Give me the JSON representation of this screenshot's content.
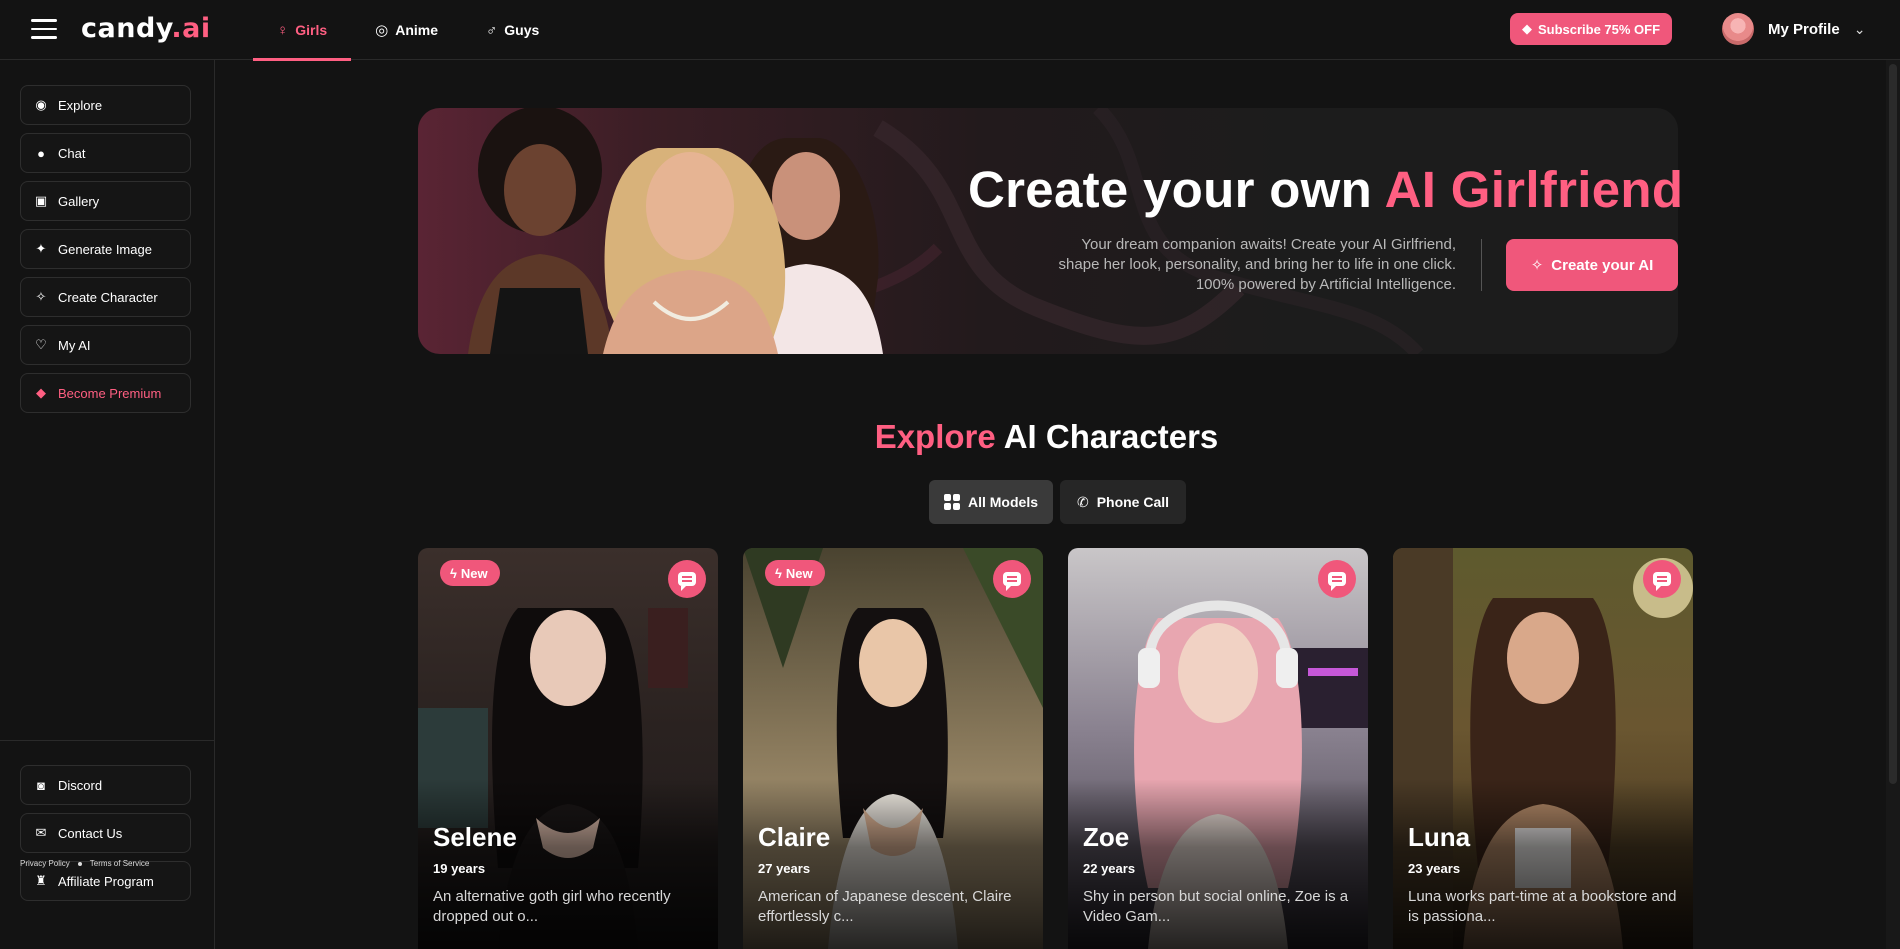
{
  "header": {
    "logo": {
      "main": "candy",
      "dot": ".",
      "suffix": "ai"
    },
    "tabs": [
      {
        "label": "Girls",
        "icon": "female-icon",
        "active": true
      },
      {
        "label": "Anime",
        "icon": "anime-icon",
        "active": false
      },
      {
        "label": "Guys",
        "icon": "male-icon",
        "active": false
      }
    ],
    "subscribe_label": "Subscribe 75% OFF",
    "profile_label": "My Profile"
  },
  "sidebar": {
    "items": [
      {
        "label": "Explore",
        "icon": "compass-icon"
      },
      {
        "label": "Chat",
        "icon": "chat-icon"
      },
      {
        "label": "Gallery",
        "icon": "gallery-icon"
      },
      {
        "label": "Generate Image",
        "icon": "image-generate-icon"
      },
      {
        "label": "Create Character",
        "icon": "magic-wand-icon"
      },
      {
        "label": "My AI",
        "icon": "heart-icon"
      },
      {
        "label": "Become Premium",
        "icon": "diamond-icon"
      }
    ],
    "bottom_items": [
      {
        "label": "Discord",
        "icon": "discord-icon"
      },
      {
        "label": "Contact Us",
        "icon": "contact-icon"
      },
      {
        "label": "Affiliate Program",
        "icon": "trophy-icon"
      }
    ],
    "legal": {
      "privacy": "Privacy Policy",
      "terms": "Terms of Service"
    }
  },
  "hero": {
    "title_start": "Create your own",
    "title_highlight": "AI Girlfriend",
    "description": "Your dream companion awaits! Create your AI Girlfriend, shape her look, personality, and bring her to life in one click. 100% powered by Artificial Intelligence.",
    "cta_label": "Create your AI"
  },
  "explore": {
    "title_highlight": "Explore",
    "title_rest": "AI Characters",
    "filters": [
      {
        "label": "All Models",
        "icon": "grid-icon",
        "active": true
      },
      {
        "label": "Phone Call",
        "icon": "phone-icon",
        "active": false
      }
    ]
  },
  "characters": [
    {
      "name": "Selene",
      "age": "19 years",
      "desc": "An alternative goth girl who recently dropped out o...",
      "badge": "New"
    },
    {
      "name": "Claire",
      "age": "27 years",
      "desc": "American of Japanese descent, Claire effortlessly c...",
      "badge": "New"
    },
    {
      "name": "Zoe",
      "age": "22 years",
      "desc": "Shy in person but social online, Zoe is a Video Gam...",
      "badge": ""
    },
    {
      "name": "Luna",
      "age": "23 years",
      "desc": "Luna works part-time at a bookstore and is passiona...",
      "badge": ""
    }
  ],
  "colors": {
    "accent": "#f0577b",
    "background": "#131313"
  }
}
